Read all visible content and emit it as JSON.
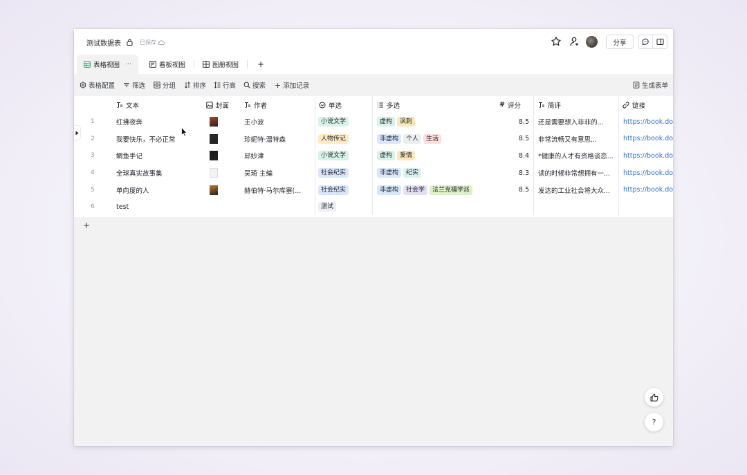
{
  "app": {
    "title": "测试数据表",
    "saved_status": "已保存",
    "share_label": "分享"
  },
  "tabs": [
    {
      "label": "表格视图",
      "more": "···"
    },
    {
      "label": "看板视图"
    },
    {
      "label": "图册视图"
    },
    {
      "label": "+"
    }
  ],
  "toolbar": {
    "config": "表格配置",
    "filter": "筛选",
    "group": "分组",
    "sort": "排序",
    "row_height": "行高",
    "search": "搜索",
    "add_record": "添加记录",
    "generate_form": "生成表单"
  },
  "columns": {
    "text": "文本",
    "cover": "封面",
    "author": "作者",
    "single": "单选",
    "multi": "多选",
    "rating": "评分",
    "review": "简评",
    "link": "链接"
  },
  "rows": [
    {
      "n": "1",
      "text": "红拂夜奔",
      "cover": "#b3471d",
      "author": "王小波",
      "single": "小说文学",
      "multi": [
        "虚构",
        "讽刺"
      ],
      "rating": "8.5",
      "review": "还是需要想入非非的...",
      "link": "https://book.dou"
    },
    {
      "n": "2",
      "text": "我要快乐，不必正常",
      "cover": "#2a2a2a",
      "author": "珍妮特·温特森",
      "single": "人物传记",
      "multi": [
        "非虚构",
        "个人",
        "生活"
      ],
      "rating": "8.5",
      "review": "非常流畅又有意思...",
      "link": "https://book.dou"
    },
    {
      "n": "3",
      "text": "鲷鱼手记",
      "cover": "#1a1a1a",
      "author": "邱妙津",
      "single": "小说文学",
      "multi": [
        "虚构",
        "爱情"
      ],
      "rating": "8.4",
      "review": "*健康的人才有资格谈恋...",
      "link": "https://book.dou"
    },
    {
      "n": "4",
      "text": "全球真实故事集",
      "cover": "#eeeeee",
      "author": "吴琦 主编",
      "single": "社会纪实",
      "multi": [
        "非虚构",
        "纪实"
      ],
      "rating": "8.3",
      "review": "读的时候非常想拥有一...",
      "link": "https://book.dou"
    },
    {
      "n": "5",
      "text": "单向度的人",
      "cover": "#c87a2c",
      "author": "赫伯特·马尔库塞(...",
      "single": "社会纪实",
      "multi": [
        "非虚构",
        "社会学",
        "法兰克福学派"
      ],
      "rating": "8.5",
      "review": "发达的工业社会将大众...",
      "link": "https://book.dou"
    },
    {
      "n": "6",
      "text": "test",
      "cover": "",
      "author": "",
      "single": "测试",
      "multi": [],
      "rating": "",
      "review": "",
      "link": ""
    }
  ],
  "tag_colors": {
    "小说文学": [
      "#d7f2e6",
      "#1f2329"
    ],
    "人物传记": [
      "#fde9c4",
      "#1f2329"
    ],
    "社会纪实": [
      "#d9e7fc",
      "#1f2329"
    ],
    "测试": [
      "#eceeF1",
      "#1f2329"
    ],
    "虚构": [
      "#d7f2e6",
      "#1f2329"
    ],
    "讽刺": [
      "#fbe7b8",
      "#1f2329"
    ],
    "非虚构": [
      "#d9e7fc",
      "#1f2329"
    ],
    "个人": [
      "#eceef1",
      "#1f2329"
    ],
    "生活": [
      "#fcdede",
      "#1f2329"
    ],
    "爱情": [
      "#fbe7b8",
      "#1f2329"
    ],
    "纪实": [
      "#d9f1ef",
      "#1f2329"
    ],
    "社会学": [
      "#e6e0f7",
      "#1f2329"
    ],
    "法兰克福学派": [
      "#def1c9",
      "#1f2329"
    ]
  },
  "add_row_label": "+",
  "help_label": "?"
}
